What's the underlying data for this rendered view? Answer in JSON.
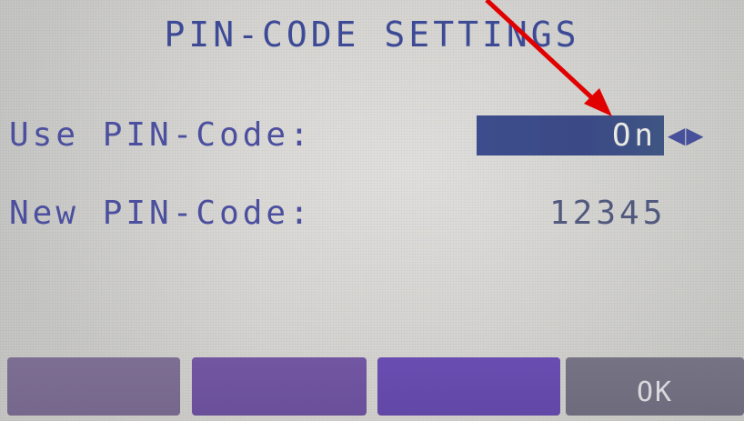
{
  "screen": {
    "title": "PIN-CODE SETTINGS"
  },
  "settings": {
    "use_pin": {
      "label": "Use PIN-Code:",
      "value": "On",
      "arrows": "◀▶"
    },
    "new_pin": {
      "label": "New PIN-Code:",
      "value": "12345"
    }
  },
  "softkeys": [
    {
      "label": ""
    },
    {
      "label": ""
    },
    {
      "label": ""
    },
    {
      "label": "OK"
    }
  ],
  "colors": {
    "text_primary": "#3d4a96",
    "selection_background": "#3d4c8c",
    "annotation_arrow": "#e10000"
  }
}
